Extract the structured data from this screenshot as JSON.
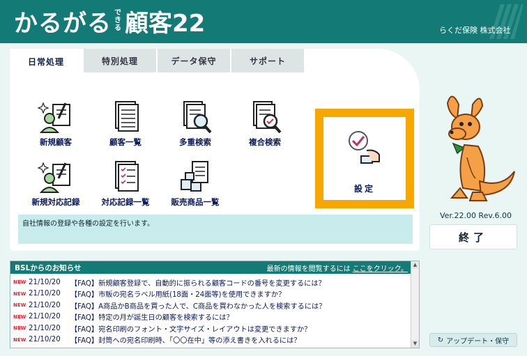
{
  "header": {
    "logo_main": "かるがる",
    "logo_small": "できる",
    "logo_product": "顧客22",
    "company": "らくだ保険 株式会社"
  },
  "tabs": [
    {
      "label": "日常処理",
      "active": true
    },
    {
      "label": "特別処理",
      "active": false
    },
    {
      "label": "データ保守",
      "active": false
    },
    {
      "label": "サポート",
      "active": false
    }
  ],
  "functions": [
    {
      "label": "新規顧客",
      "icon": "new-customer-icon"
    },
    {
      "label": "顧客一覧",
      "icon": "customer-list-icon"
    },
    {
      "label": "多重検索",
      "icon": "multi-search-icon"
    },
    {
      "label": "複合検索",
      "icon": "compound-search-icon"
    },
    {
      "label": "新規対応記録",
      "icon": "new-record-icon"
    },
    {
      "label": "対応記録一覧",
      "icon": "record-list-icon"
    },
    {
      "label": "販売商品一覧",
      "icon": "product-list-icon"
    }
  ],
  "settings": {
    "label": "設定",
    "icon": "settings-icon"
  },
  "description": "自社情報の登録や各種の設定を行います。",
  "version": "Ver.22.00 Rev.6.00",
  "exit_label": "終了",
  "update_label": "アップデート・保守",
  "news": {
    "title": "BSLからのお知らせ",
    "link_prefix": "最新の情報を閲覧するには",
    "link_text": "ここをクリック。",
    "new_badge": "NEW",
    "items": [
      {
        "date": "21/10/20",
        "text": "【FAQ】新規顧客登録で、自動的に振られる顧客コードの番号を変更するには？"
      },
      {
        "date": "21/10/20",
        "text": "【FAQ】市販の宛名ラベル用紙(18面・24面等)を使用できますか？"
      },
      {
        "date": "21/10/20",
        "text": "【FAQ】A商品かB商品を買った人で、C商品を買わなかった人を検索するには？"
      },
      {
        "date": "21/10/20",
        "text": "【FAQ】特定の月が誕生日の顧客を検索するには？"
      },
      {
        "date": "21/10/20",
        "text": "【FAQ】宛名印刷のフォント・文字サイズ・レイアウトは変更できますか？"
      },
      {
        "date": "21/10/20",
        "text": "【FAQ】封筒への宛名印刷時、「〇〇在中」等の添え書きを入れるには？"
      }
    ]
  },
  "colors": {
    "header": "#137a75",
    "accent": "#f7a800",
    "background": "#e9f6f4",
    "link_blue": "#0c1a5a"
  }
}
